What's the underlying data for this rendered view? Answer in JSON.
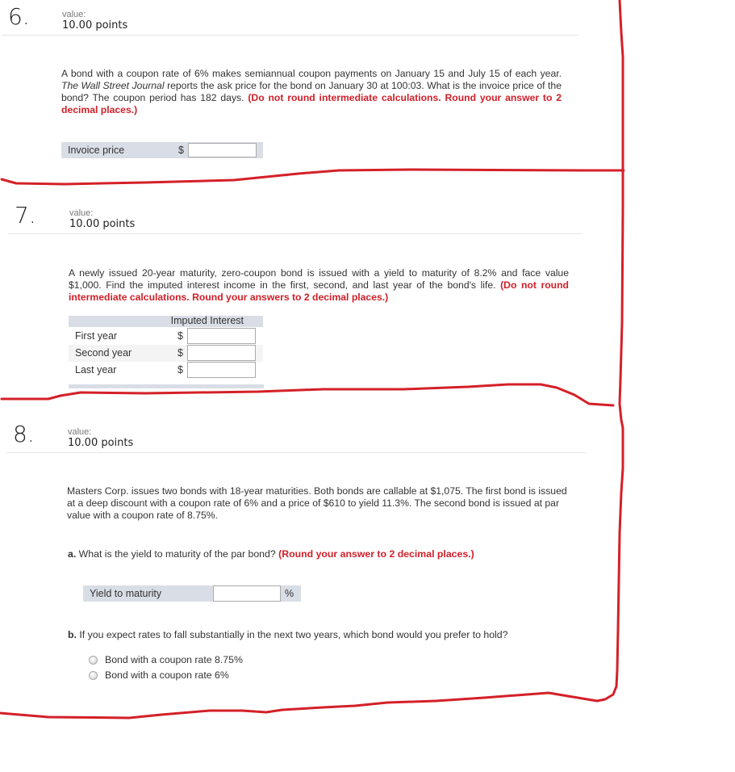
{
  "questions": [
    {
      "number": "6.",
      "value_label": "value:",
      "points": "10.00 points",
      "text_plain_1": "A bond with a coupon rate of 6% makes semiannual coupon payments on January 15 and July 15 of each year. ",
      "text_italic": "The Wall Street Journal",
      "text_plain_2": " reports the ask price for the bond on January 30 at 100:03. What is the invoice price of the bond? The coupon period has 182 days. ",
      "text_red": "(Do not round intermediate calculations. Round your answer to 2 decimal places.)",
      "answer": {
        "label": "Invoice price",
        "currency": "$",
        "value": ""
      }
    },
    {
      "number": "7.",
      "value_label": "value:",
      "points": "10.00 points",
      "text_plain": "A newly issued 20-year maturity, zero-coupon bond is issued with a yield to maturity of 8.2% and face value $1,000. Find the imputed interest income in the first, second, and last year of the bond's life. ",
      "text_red": "(Do not round intermediate calculations. Round your answers to 2 decimal places.)",
      "table": {
        "column_header": "Imputed Interest",
        "rows": [
          {
            "label": "First year",
            "currency": "$",
            "value": ""
          },
          {
            "label": "Second year",
            "currency": "$",
            "value": ""
          },
          {
            "label": "Last year",
            "currency": "$",
            "value": ""
          }
        ]
      }
    },
    {
      "number": "8.",
      "value_label": "value:",
      "points": "10.00 points",
      "text_plain": "Masters Corp. issues two bonds with 18-year maturities. Both bonds are callable at $1,075. The first bond is issued at a deep discount with a coupon rate of 6% and a price of $610 to yield 11.3%. The second bond is issued at par value with a coupon rate of 8.75%.",
      "part_a": {
        "letter": "a.",
        "text": " What is the yield to maturity of the par bond? ",
        "text_red": "(Round your answer to 2 decimal places.)",
        "answer": {
          "label": "Yield to maturity",
          "unit": "%",
          "value": ""
        }
      },
      "part_b": {
        "letter": "b.",
        "text": " If you expect rates to fall substantially in the next two years, which bond would you prefer to hold?",
        "options": [
          {
            "label": "Bond with a coupon rate 8.75%",
            "selected": false
          },
          {
            "label": "Bond with a coupon rate 6%",
            "selected": false
          }
        ]
      }
    }
  ],
  "annotation": {
    "color": "#d42028"
  }
}
